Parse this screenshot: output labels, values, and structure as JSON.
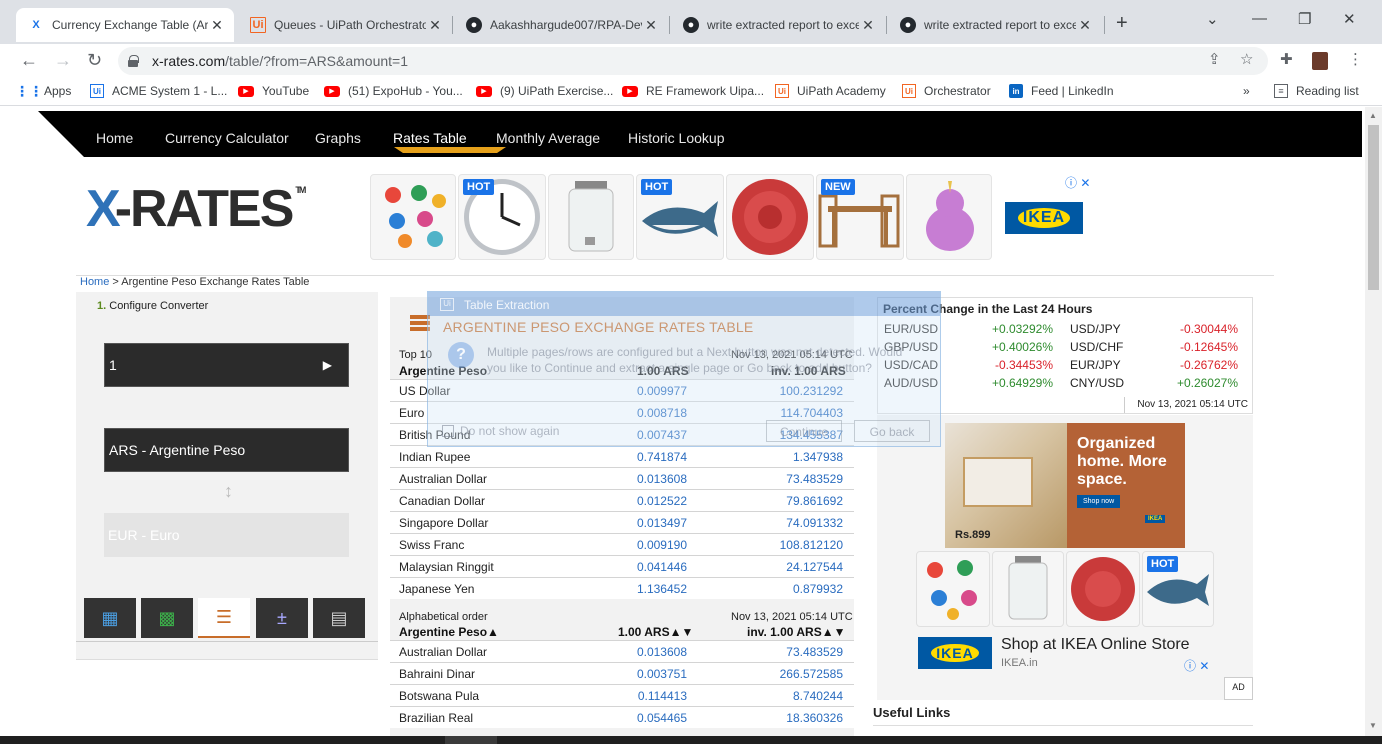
{
  "browser": {
    "tabs": [
      {
        "title": "Currency Exchange Table (Arg",
        "favicon": "x-rates-icon",
        "active": true
      },
      {
        "title": "Queues - UiPath Orchestrator",
        "favicon": "uipath-icon",
        "active": false
      },
      {
        "title": "Aakashhargude007/RPA-Dev",
        "favicon": "github-icon",
        "active": false
      },
      {
        "title": "write extracted report to exce",
        "favicon": "github-icon",
        "active": false
      },
      {
        "title": "write extracted report to exce",
        "favicon": "github-icon",
        "active": false
      }
    ],
    "url_host": "x-rates.com",
    "url_path": "/table/?from=ARS&amount=1",
    "bookmarks": [
      {
        "label": "Apps",
        "icon": "apps-grid-icon"
      },
      {
        "label": "ACME System 1 - L...",
        "icon": "uipath-icon"
      },
      {
        "label": "YouTube",
        "icon": "youtube-icon"
      },
      {
        "label": "(51) ExpoHub - You...",
        "icon": "youtube-icon"
      },
      {
        "label": "(9) UiPath Exercise...",
        "icon": "youtube-icon"
      },
      {
        "label": "RE Framework Uipa...",
        "icon": "youtube-icon"
      },
      {
        "label": "UiPath Academy",
        "icon": "uipath-icon"
      },
      {
        "label": "Orchestrator",
        "icon": "uipath-icon"
      },
      {
        "label": "Feed | LinkedIn",
        "icon": "linkedin-icon"
      }
    ],
    "more_bookmarks": "»",
    "reading_list": "Reading list"
  },
  "site": {
    "nav": [
      "Home",
      "Currency Calculator",
      "Graphs",
      "Rates Table",
      "Monthly Average",
      "Historic Lookup"
    ],
    "active_nav": "Rates Table",
    "logo": "X-RATES",
    "logo_tm": "TM",
    "ad_badges": {
      "hot": "HOT",
      "new": "NEW"
    },
    "ikea": "IKEA",
    "breadcrumb_home": "Home",
    "breadcrumb_rest": " > Argentine Peso Exchange Rates Table"
  },
  "converter": {
    "step_num": "1.",
    "step_label": "Configure Converter",
    "amount": "1",
    "go": "▶",
    "from": "ARS - Argentine Peso",
    "to": "EUR - Euro",
    "swap": "↕"
  },
  "table": {
    "title": "ARGENTINE PESO EXCHANGE RATES TABLE",
    "top10": {
      "caption": "Top 10",
      "timestamp": "Nov 13, 2021 05:14 UTC",
      "col1": "Argentine Peso",
      "col2": "1.00 ARS",
      "col3": "inv. 1.00 ARS",
      "rows": [
        [
          "US Dollar",
          "0.009977",
          "100.231292"
        ],
        [
          "Euro",
          "0.008718",
          "114.704403"
        ],
        [
          "British Pound",
          "0.007437",
          "134.455387"
        ],
        [
          "Indian Rupee",
          "0.741874",
          "1.347938"
        ],
        [
          "Australian Dollar",
          "0.013608",
          "73.483529"
        ],
        [
          "Canadian Dollar",
          "0.012522",
          "79.861692"
        ],
        [
          "Singapore Dollar",
          "0.013497",
          "74.091332"
        ],
        [
          "Swiss Franc",
          "0.009190",
          "108.812120"
        ],
        [
          "Malaysian Ringgit",
          "0.041446",
          "24.127544"
        ],
        [
          "Japanese Yen",
          "1.136452",
          "0.879932"
        ]
      ]
    },
    "alpha": {
      "caption": "Alphabetical order",
      "timestamp": "Nov 13, 2021 05:14 UTC",
      "col1": "Argentine Peso▲",
      "col2": "1.00 ARS▲▼",
      "col3": "inv. 1.00 ARS▲▼",
      "rows": [
        [
          "Australian Dollar",
          "0.013608",
          "73.483529"
        ],
        [
          "Bahraini Dinar",
          "0.003751",
          "266.572585"
        ],
        [
          "Botswana Pula",
          "0.114413",
          "8.740244"
        ],
        [
          "Brazilian Real",
          "0.054465",
          "18.360326"
        ]
      ]
    }
  },
  "percent_change": {
    "title": "Percent Change in the Last 24 Hours",
    "left": [
      {
        "pair": "EUR/USD",
        "value": "+0.03292%",
        "dir": "up"
      },
      {
        "pair": "GBP/USD",
        "value": "+0.40026%",
        "dir": "up"
      },
      {
        "pair": "USD/CAD",
        "value": "-0.34453%",
        "dir": "down"
      },
      {
        "pair": "AUD/USD",
        "value": "+0.64929%",
        "dir": "up"
      }
    ],
    "right": [
      {
        "pair": "USD/JPY",
        "value": "-0.30044%",
        "dir": "down"
      },
      {
        "pair": "USD/CHF",
        "value": "-0.12645%",
        "dir": "down"
      },
      {
        "pair": "EUR/JPY",
        "value": "-0.26762%",
        "dir": "down"
      },
      {
        "pair": "CNY/USD",
        "value": "+0.26027%",
        "dir": "up"
      }
    ],
    "timestamp": "Nov 13, 2021 05:14 UTC"
  },
  "right_ad": {
    "headline": "Organized home. More space.",
    "shop_now": "Shop now",
    "price": "Rs.899",
    "store_title": "Shop at IKEA Online Store",
    "domain": "IKEA.in",
    "ad_label": "AD"
  },
  "useful_links": "Useful Links",
  "dialog": {
    "title": "Table Extraction",
    "message": "Multiple pages/rows are configured but a Next button was not detected. Would you like to Continue and extract a single page or Go back to add button?",
    "checkbox": "Do not show again",
    "continue": "Continue",
    "go_back": "Go back"
  },
  "colors": {
    "accent_orange": "#c86d2a",
    "link_blue": "#2a6cbf",
    "positive": "#2e8b2e",
    "negative": "#d9222a"
  }
}
